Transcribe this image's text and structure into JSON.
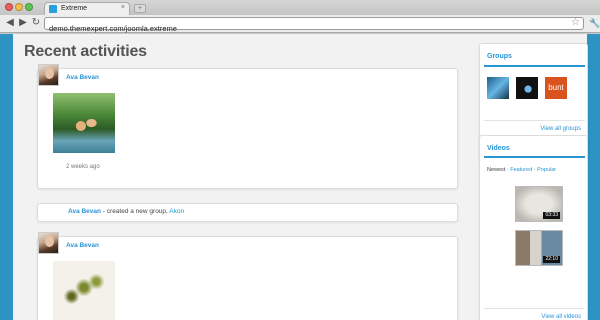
{
  "browser": {
    "tab_title": "Extreme",
    "url": "demo.themexpert.com/joomla.extreme",
    "new_tab_symbol": "+"
  },
  "page": {
    "title": "Recent activities"
  },
  "activities": [
    {
      "user": "Ava Bevan",
      "time_ago": "2 weeks ago"
    },
    {
      "user": "Ava Bevan",
      "action": " - created a new group, ",
      "target": "Akon"
    },
    {
      "user": "Ava Bevan"
    }
  ],
  "sidebar": {
    "groups": {
      "title": "Groups",
      "thumb3_text": "bunt",
      "view_all": "View all groups"
    },
    "videos": {
      "title": "Videos",
      "tabs": {
        "active": "Newest",
        "featured": "Featured",
        "popular": "Popular",
        "separator": " · "
      },
      "items": [
        {
          "duration": "03:33"
        },
        {
          "duration": "22:10"
        }
      ],
      "view_all": "View all videos"
    }
  },
  "colors": {
    "accent": "#2a94d3",
    "frame": "#2d93c4",
    "content_bg": "#f2f2f2"
  },
  "icons": [
    "back-icon",
    "forward-icon",
    "reload-icon",
    "star-icon",
    "wrench-icon",
    "close-icon"
  ]
}
